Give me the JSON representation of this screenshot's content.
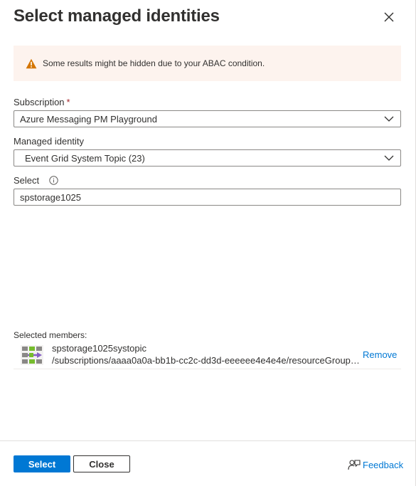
{
  "panel": {
    "title": "Select managed identities"
  },
  "warning": {
    "text": "Some results might be hidden due to your ABAC condition."
  },
  "subscription": {
    "label": "Subscription",
    "required_mark": "*",
    "value": "Azure Messaging PM Playground"
  },
  "managed_identity": {
    "label": "Managed identity",
    "value": "Event Grid System Topic (23)"
  },
  "select": {
    "label": "Select",
    "value": "spstorage1025"
  },
  "selected_members": {
    "label": "Selected members:",
    "items": [
      {
        "name": "spstorage1025systopic",
        "path": "/subscriptions/aaaa0a0a-bb1b-cc2c-dd3d-eeeeee4e4e4e/resourceGroups/...",
        "remove_label": "Remove"
      }
    ]
  },
  "footer": {
    "select_label": "Select",
    "close_label": "Close",
    "feedback_label": "Feedback"
  },
  "colors": {
    "accent": "#0078d4",
    "warning_bg": "#fdf3ee",
    "warning_icon": "#d47500",
    "required": "#a4262c"
  },
  "icons": {
    "close": "close-icon",
    "warning": "warning-icon",
    "chevron": "chevron-down-icon",
    "info": "info-icon",
    "member": "event-grid-system-topic-icon",
    "feedback": "feedback-icon"
  }
}
